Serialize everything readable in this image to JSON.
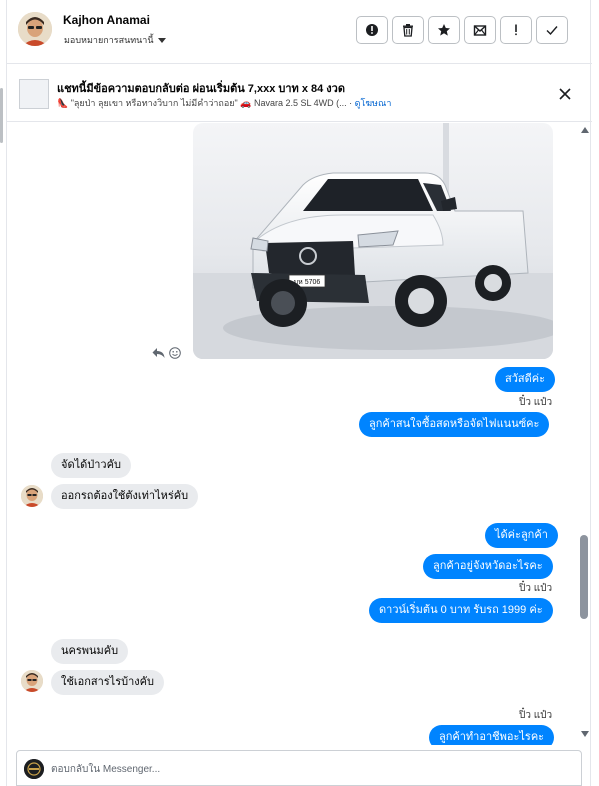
{
  "header": {
    "user_name": "Kajhon Anamai",
    "assign_label": "มอบหมายการสนทนานี้",
    "actions": [
      {
        "name": "report-button",
        "icon": "alert-circle-icon"
      },
      {
        "name": "delete-button",
        "icon": "trash-icon"
      },
      {
        "name": "star-button",
        "icon": "star-icon"
      },
      {
        "name": "mark-unread-button",
        "icon": "envelope-icon"
      },
      {
        "name": "important-button",
        "icon": "exclamation-icon"
      },
      {
        "name": "done-button",
        "icon": "check-icon"
      }
    ]
  },
  "ad": {
    "title": "แชทนี้มีข้อความตอบกลับต่อ ผ่อนเริ่มต้น 7,xxx บาท x 84 งวด",
    "subtitle": "👠 \"ลุยป่า ลุยเขา หรือทางวิบาก ไม่มีคำว่าถอย\" 🚗 Navara 2.5 SL 4WD (...",
    "link": "ดูโฆษณา"
  },
  "messages": {
    "m1": "สวัสดีค่ะ",
    "sender1": "ปิ๋ว แป๋ว",
    "m2": "ลูกค้าสนใจซื้อสดหรือจัดไฟแนนซ์คะ",
    "m3": "จัดได้ป่าวคับ",
    "m4": "ออกรถต้องใช้ตังเท่าไหร่คับ",
    "m5": "ได้ค่ะลูกค้า",
    "m6": "ลูกค้าอยู่จังหวัดอะไรคะ",
    "sender2": "ปิ๋ว แป๋ว",
    "m7": "ดาวน์เริ่มต้น 0 บาท รับรถ 1999 ค่ะ",
    "m8": "นครพนมคับ",
    "m9": "ใช้เอกสารไรบ้างคับ",
    "sender3": "ปิ๋ว แป๋ว",
    "m10": "ลูกค้าทำอาชีพอะไรคะ"
  },
  "photo": {
    "plate": "บห 5706"
  },
  "composer": {
    "placeholder": "ตอบกลับใน Messenger..."
  },
  "colors": {
    "outgoing": "#0084ff",
    "incoming": "#e9ebee"
  }
}
